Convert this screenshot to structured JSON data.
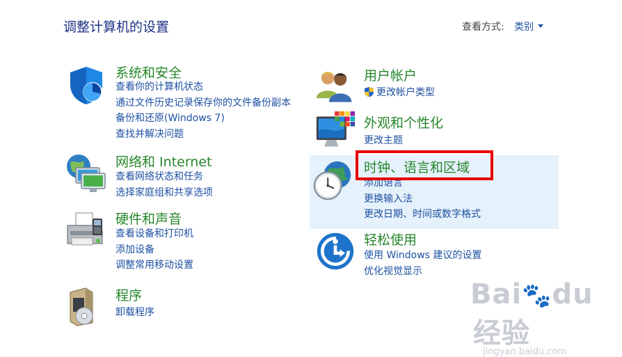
{
  "header": {
    "title": "调整计算机的设置",
    "view_by_label": "查看方式:",
    "view_by_value": "类别"
  },
  "categories_left": [
    {
      "title": "系统和安全",
      "icon": "shield-system-icon",
      "links": [
        "查看你的计算机状态",
        "通过文件历史记录保存你的文件备份副本",
        "备份和还原(Windows 7)",
        "查找并解决问题"
      ]
    },
    {
      "title": "网络和 Internet",
      "icon": "network-globe-icon",
      "links": [
        "查看网络状态和任务",
        "选择家庭组和共享选项"
      ]
    },
    {
      "title": "硬件和声音",
      "icon": "printer-icon",
      "links": [
        "查看设备和打印机",
        "添加设备",
        "调整常用移动设置"
      ]
    },
    {
      "title": "程序",
      "icon": "programs-disc-icon",
      "links": [
        "卸载程序"
      ]
    }
  ],
  "categories_right": [
    {
      "title": "用户帐户",
      "icon": "users-icon",
      "links": [
        "更改帐户类型"
      ]
    },
    {
      "title": "外观和个性化",
      "icon": "monitor-color-icon",
      "links": [
        "更改主题"
      ]
    },
    {
      "title": "时钟、语言和区域",
      "icon": "globe-clock-icon",
      "links": [
        "添加语言",
        "更换输入法",
        "更改日期、时间或数字格式"
      ]
    },
    {
      "title": "轻松使用",
      "icon": "ease-of-access-icon",
      "links": [
        "使用 Windows 建议的设置",
        "优化视觉显示"
      ]
    }
  ],
  "watermark": {
    "brand": "经验",
    "url": "jingyan.baidu.com"
  },
  "colors": {
    "title_blue": "#1e3287",
    "category_green": "#26862b",
    "link_blue": "#1e50a2",
    "highlight_bg": "#e5f1fb",
    "annotation_red": "#e60000"
  }
}
